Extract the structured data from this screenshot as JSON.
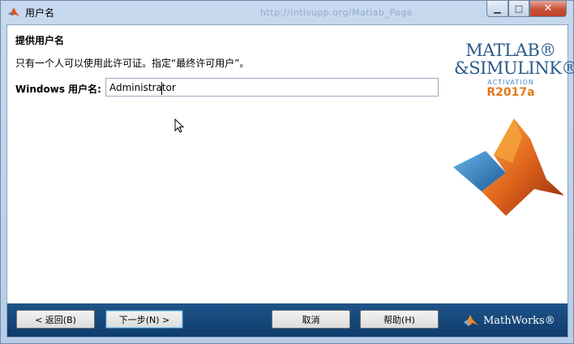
{
  "window": {
    "title": "用户名",
    "background_title": "http://intlsupp.org/Matlab_Page"
  },
  "page": {
    "heading": "提供用户名",
    "instruction": "只有一个人可以使用此许可证。指定“最终许可用户”。",
    "field_label": "Windows 用户名:",
    "field_value": "Administrator"
  },
  "logo": {
    "line1": "MATLAB®",
    "line2": "&SIMULINK®",
    "activation": "ACTIVATION",
    "release": "R2017a"
  },
  "footer": {
    "back_label": "< 返回(B)",
    "next_label": "下一步(N) >",
    "cancel_label": "取消",
    "help_label": "帮助(H)",
    "mathworks": "MathWorks®"
  },
  "colors": {
    "accent_blue": "#1f5489",
    "logo_orange": "#e07a1b",
    "logo_blue": "#2b5a8a"
  },
  "icons": {
    "app": "matlab-icon",
    "minimize": "minimize-icon",
    "maximize": "maximize-icon",
    "close": "close-icon"
  }
}
